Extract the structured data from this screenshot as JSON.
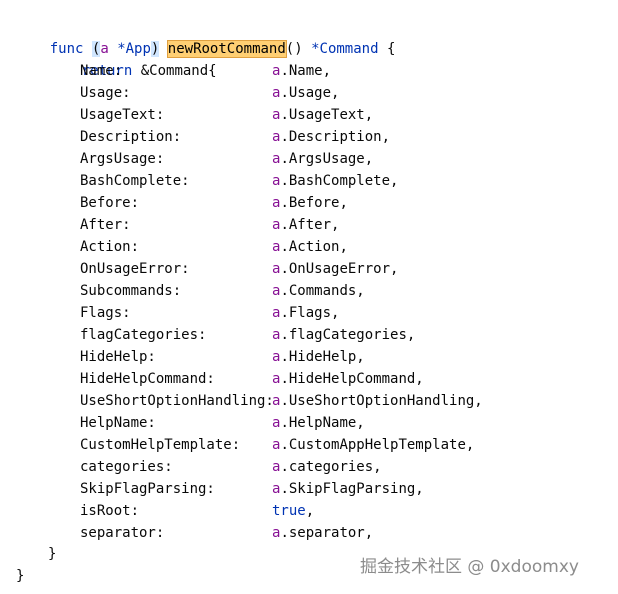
{
  "header": {
    "kw_func": "func",
    "open_paren": "(",
    "receiver": "a",
    "receiver_type": "*App",
    "close_paren": ")",
    "func_name": "newRootCommand",
    "sig_tail": "() ",
    "return_type": "*Command",
    "open_brace": " {"
  },
  "return_line": {
    "kw_return": "return",
    "expr": "&Command{"
  },
  "fields": [
    {
      "name": "Name:",
      "recv": "a",
      "value": ".Name,"
    },
    {
      "name": "Usage:",
      "recv": "a",
      "value": ".Usage,"
    },
    {
      "name": "UsageText:",
      "recv": "a",
      "value": ".UsageText,"
    },
    {
      "name": "Description:",
      "recv": "a",
      "value": ".Description,"
    },
    {
      "name": "ArgsUsage:",
      "recv": "a",
      "value": ".ArgsUsage,"
    },
    {
      "name": "BashComplete:",
      "recv": "a",
      "value": ".BashComplete,"
    },
    {
      "name": "Before:",
      "recv": "a",
      "value": ".Before,"
    },
    {
      "name": "After:",
      "recv": "a",
      "value": ".After,"
    },
    {
      "name": "Action:",
      "recv": "a",
      "value": ".Action,"
    },
    {
      "name": "OnUsageError:",
      "recv": "a",
      "value": ".OnUsageError,"
    },
    {
      "name": "Subcommands:",
      "recv": "a",
      "value": ".Commands,"
    },
    {
      "name": "Flags:",
      "recv": "a",
      "value": ".Flags,"
    },
    {
      "name": "flagCategories:",
      "recv": "a",
      "value": ".flagCategories,"
    },
    {
      "name": "HideHelp:",
      "recv": "a",
      "value": ".HideHelp,"
    },
    {
      "name": "HideHelpCommand:",
      "recv": "a",
      "value": ".HideHelpCommand,"
    },
    {
      "name": "UseShortOptionHandling:",
      "recv": "a",
      "value": ".UseShortOptionHandling,"
    },
    {
      "name": "HelpName:",
      "recv": "a",
      "value": ".HelpName,"
    },
    {
      "name": "CustomHelpTemplate:",
      "recv": "a",
      "value": ".CustomAppHelpTemplate,"
    },
    {
      "name": "categories:",
      "recv": "a",
      "value": ".categories,"
    },
    {
      "name": "SkipFlagParsing:",
      "recv": "a",
      "value": ".SkipFlagParsing,"
    },
    {
      "name": "isRoot:",
      "recv": "true",
      "value": ","
    },
    {
      "name": "separator:",
      "recv": "a",
      "value": ".separator,"
    }
  ],
  "closing": {
    "inner_brace": "}",
    "outer_brace": "}"
  },
  "watermark": "掘金技术社区 @ 0xdoomxy",
  "colors": {
    "keyword": "#0033b3",
    "receiver": "#871094",
    "highlight": "#ffcf73"
  }
}
